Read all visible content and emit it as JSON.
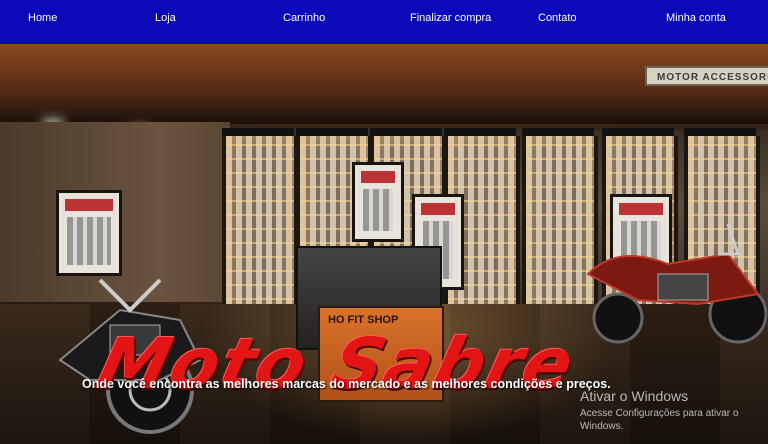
{
  "navbar": {
    "items": [
      {
        "label": "Home"
      },
      {
        "label": "Loja"
      },
      {
        "label": "Carrinho"
      },
      {
        "label": "Finalizar compra"
      },
      {
        "label": "Contato"
      },
      {
        "label": "Minha conta"
      }
    ]
  },
  "hero": {
    "sign_text": "MOTOR ACCESSORIES",
    "counter_sign": "HO FIT SHOP",
    "brand": "Moto Sabre",
    "tagline": "Onde você encontra as melhores marcas do mercado e as melhores condições e preços."
  },
  "overlay": {
    "activation_title": "Ativar o Windows",
    "activation_body": "Acesse Configurações para ativar o Windows."
  },
  "colors": {
    "nav_background": "#0a0ab8",
    "nav_text": "#ffffff",
    "brand": "#e31414"
  }
}
